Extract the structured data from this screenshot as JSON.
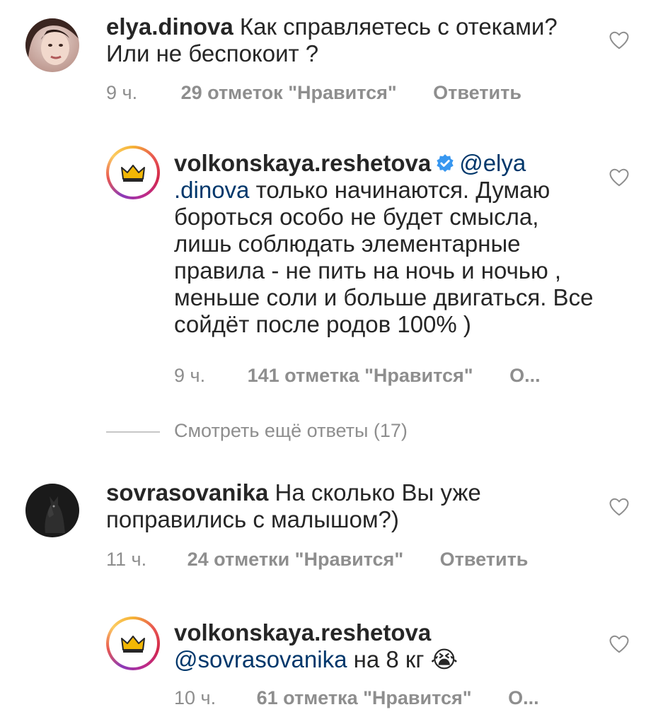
{
  "comments": [
    {
      "username": "elya.dinova",
      "text": " Как справляетесь с отеками?\nИли не беспокоит ?",
      "time": "9 ч.",
      "likes": "29 отметок \"Нравится\"",
      "reply": "Ответить"
    },
    {
      "username": "volkonskaya.reshetova",
      "mention": "@elya\n.dinova",
      "text": " только начинаются. Думаю бороться особо не будет смысла, лишь соблюдать элементарные правила - не пить на ночь и ночью , меньше соли и больше двигаться. Все сойдёт после родов 100% )",
      "time": "9 ч.",
      "likes": "141 отметка \"Нравится\"",
      "reply": "О..."
    },
    {
      "username": "sovrasovanika",
      "text": " На сколько Вы уже поправились с малышом?)",
      "time": "11 ч.",
      "likes": "24 отметки \"Нравится\"",
      "reply": "Ответить"
    },
    {
      "username": "volkonskaya.reshetova",
      "mention": "@sovrasovanika",
      "text": " на 8 кг",
      "emoji": "😭",
      "time": "10 ч.",
      "likes": "61 отметка \"Нравится\"",
      "reply": "О..."
    }
  ],
  "view_more": "Смотреть ещё ответы (17)",
  "colors": {
    "text": "#262626",
    "muted": "#8e8e8e",
    "mention": "#00376b",
    "verified": "#3897f0",
    "crown": "#f2b705"
  },
  "icons": {
    "heart": "heart-outline-icon",
    "verified": "verified-badge-icon",
    "crown": "crown-logo-icon"
  }
}
